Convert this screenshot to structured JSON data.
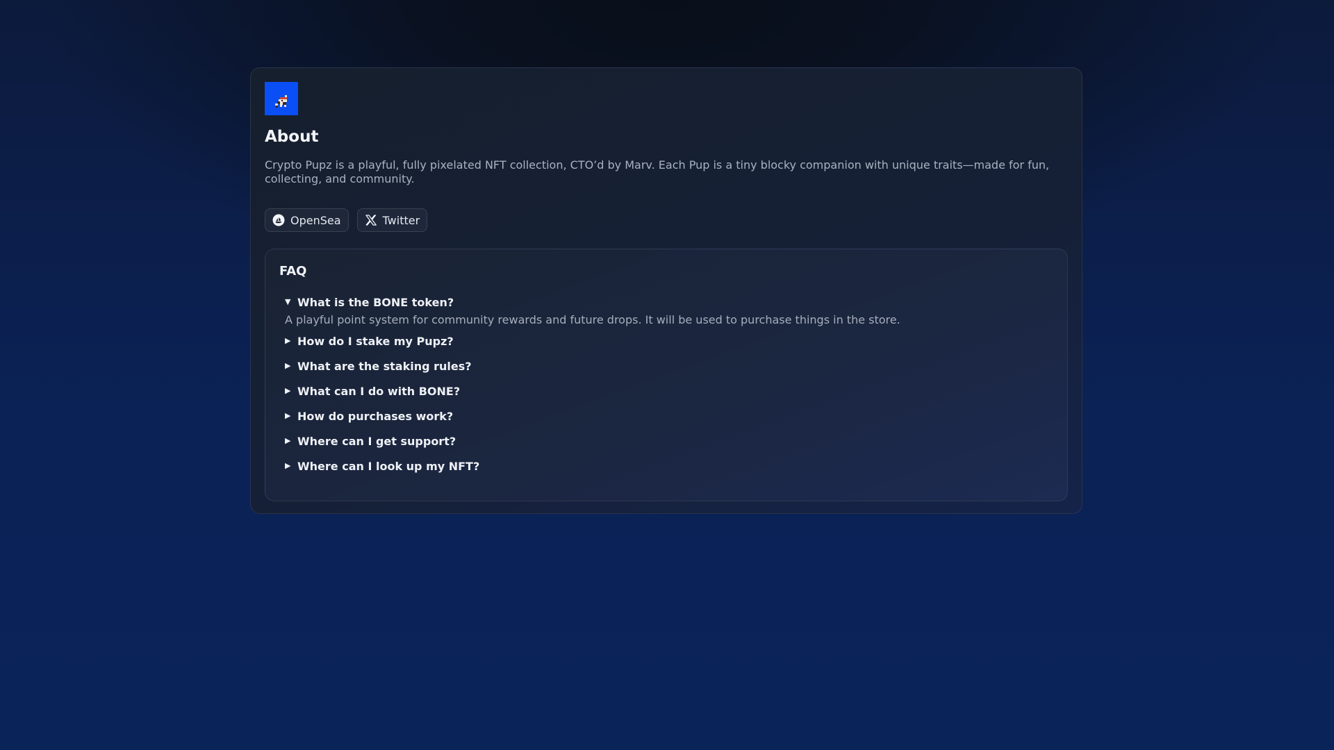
{
  "about": {
    "logo_icon": "pixel-puppy-logo",
    "logo_bg": "#0a4ef5",
    "title": "About",
    "description": "Crypto Pupz is a playful, fully pixelated NFT collection, CTO’d by Marv. Each Pup is a tiny blocky companion with unique traits—made for fun, collecting, and community."
  },
  "links": [
    {
      "label": "OpenSea",
      "icon": "opensea-icon"
    },
    {
      "label": "Twitter",
      "icon": "x-icon"
    }
  ],
  "faq": {
    "title": "FAQ",
    "items": [
      {
        "question": "What is the BONE token?",
        "answer": "A playful point system for community rewards and future drops. It will be used to purchase things in the store.",
        "expanded": true
      },
      {
        "question": "How do I stake my Pupz?",
        "expanded": false
      },
      {
        "question": "What are the staking rules?",
        "expanded": false
      },
      {
        "question": "What can I do with BONE?",
        "expanded": false
      },
      {
        "question": "How do purchases work?",
        "expanded": false
      },
      {
        "question": "Where can I get support?",
        "expanded": false
      },
      {
        "question": "Where can I look up my NFT?",
        "expanded": false
      }
    ]
  }
}
